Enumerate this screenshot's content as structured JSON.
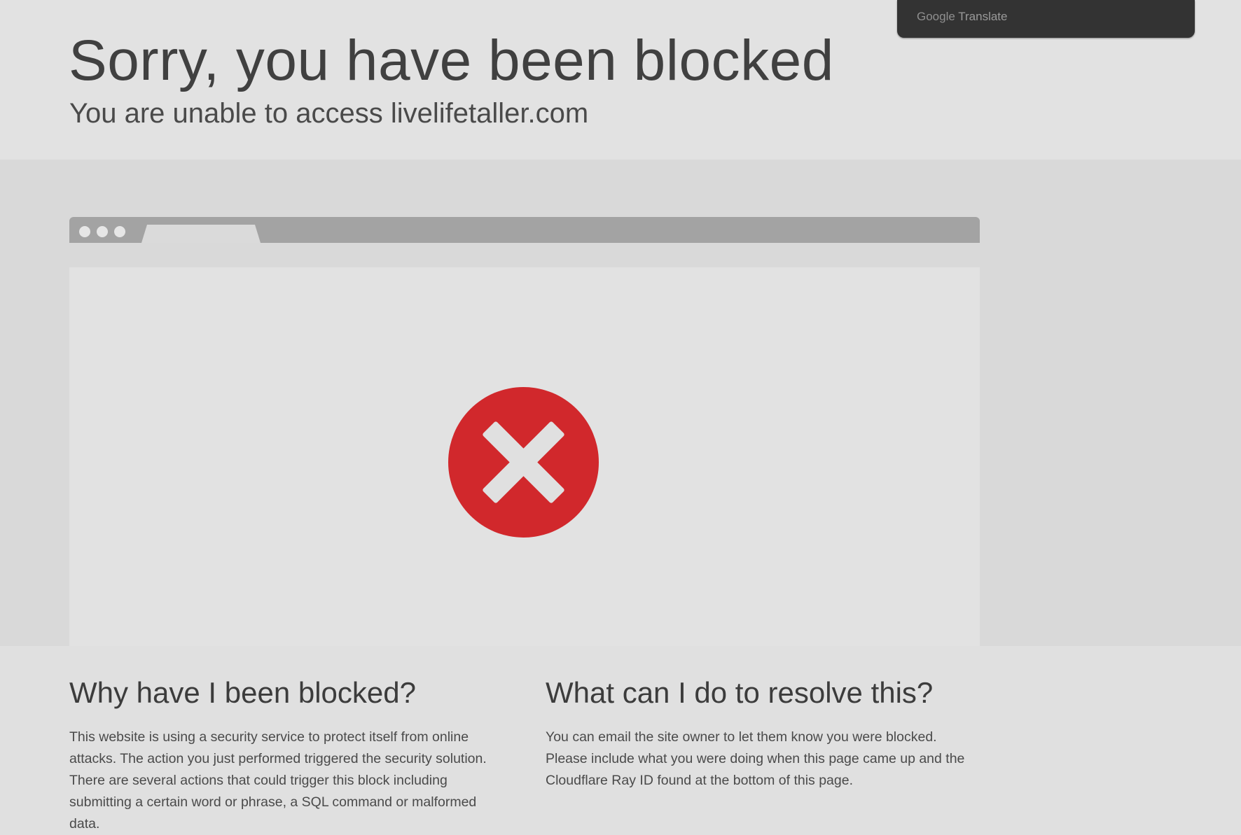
{
  "header": {
    "title": "Sorry, you have been blocked",
    "subtitle": "You are unable to access livelifetaller.com"
  },
  "translate_bar": {
    "brand": "Google",
    "label": "Translate"
  },
  "illustration": {
    "status_icon": "blocked-x-icon",
    "status_color": "#d1282c",
    "window_dots": 3
  },
  "sections": {
    "why": {
      "heading": "Why have I been blocked?",
      "body": "This website is using a security service to protect itself from online attacks. The action you just performed triggered the security solution. There are several actions that could trigger this block including submitting a certain word or phrase, a SQL command or malformed data."
    },
    "resolve": {
      "heading": "What can I do to resolve this?",
      "body": "You can email the site owner to let them know you were blocked. Please include what you were doing when this page came up and the Cloudflare Ray ID found at the bottom of this page."
    }
  },
  "colors": {
    "background": "#e0e0e0",
    "text": "#404040",
    "error_red": "#d1282c"
  }
}
